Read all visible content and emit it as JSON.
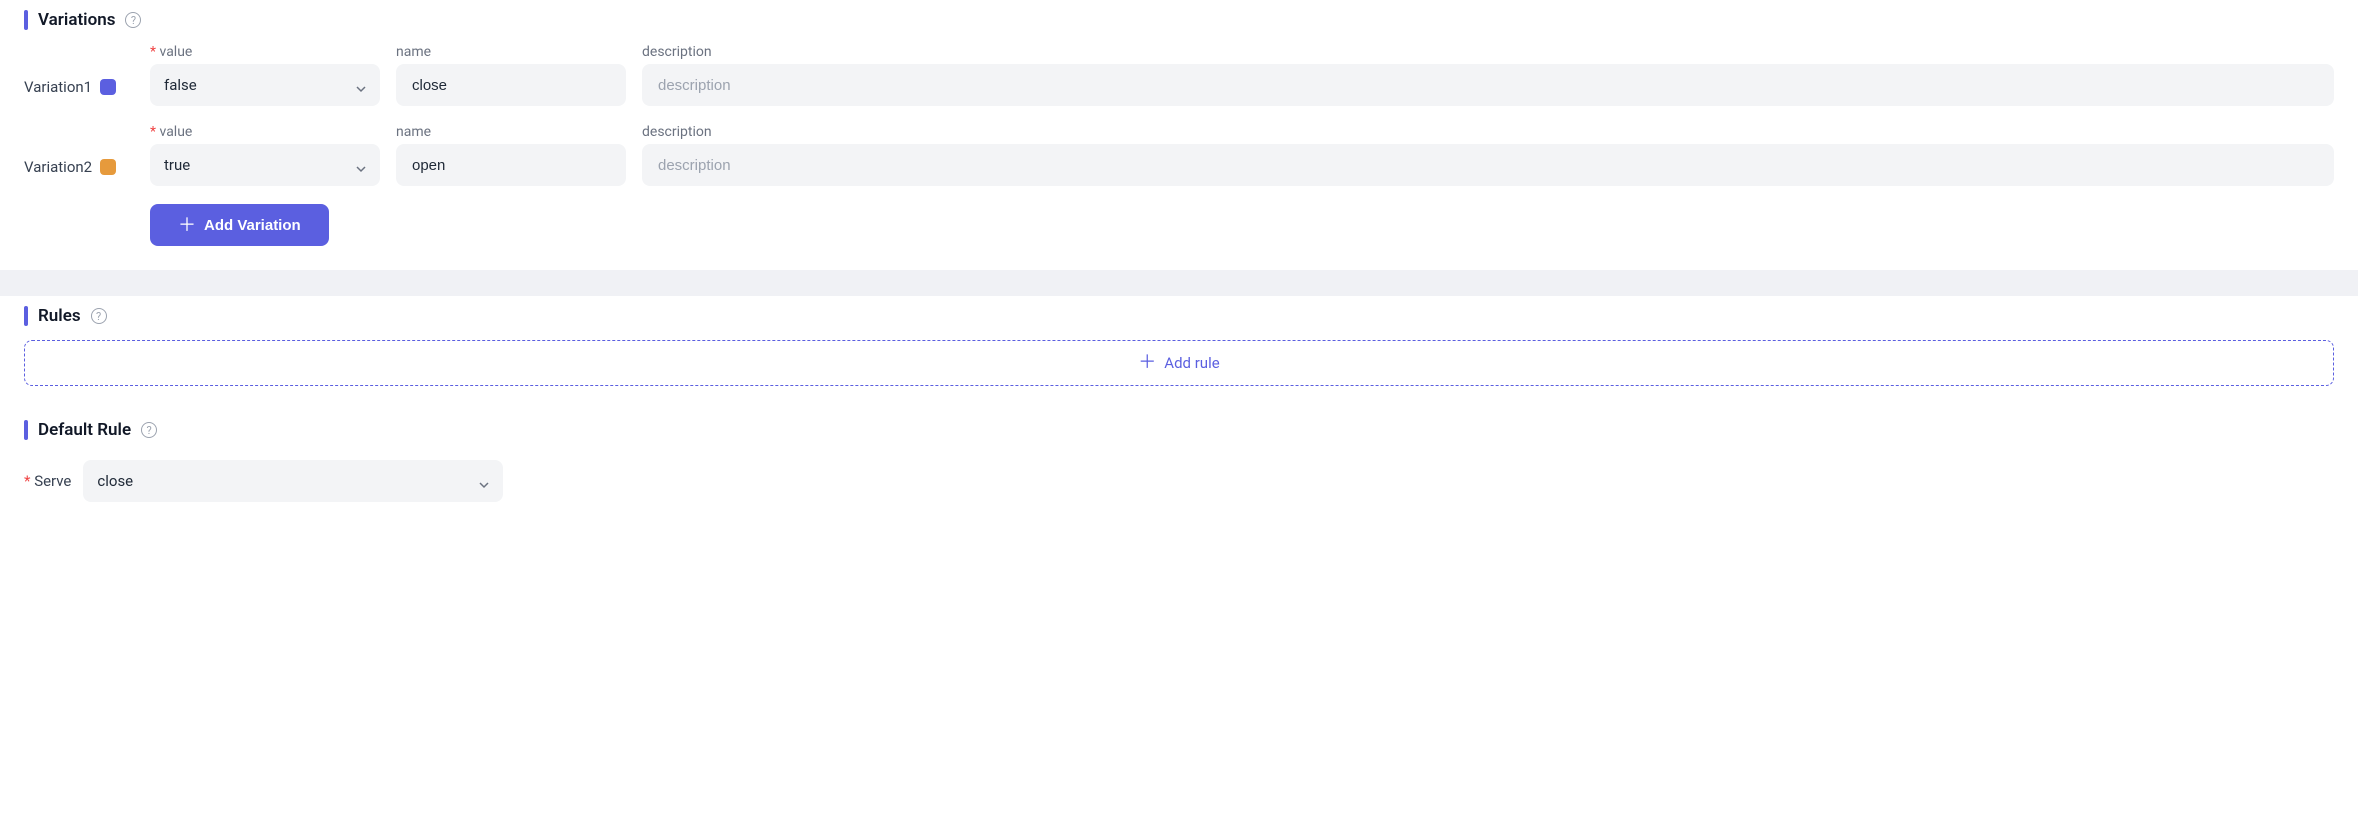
{
  "sections": {
    "variations": {
      "title": "Variations",
      "labels": {
        "value": "value",
        "name": "name",
        "description": "description"
      },
      "placeholders": {
        "description": "description"
      },
      "rows": [
        {
          "label": "Variation1",
          "color": "#5b5fe0",
          "value": "false",
          "name": "close",
          "description": ""
        },
        {
          "label": "Variation2",
          "color": "#e69a3c",
          "value": "true",
          "name": "open",
          "description": ""
        }
      ],
      "add_button": "Add Variation"
    },
    "rules": {
      "title": "Rules",
      "add_rule": "Add rule"
    },
    "default_rule": {
      "title": "Default Rule",
      "serve_label": "Serve",
      "serve_value": "close"
    }
  }
}
